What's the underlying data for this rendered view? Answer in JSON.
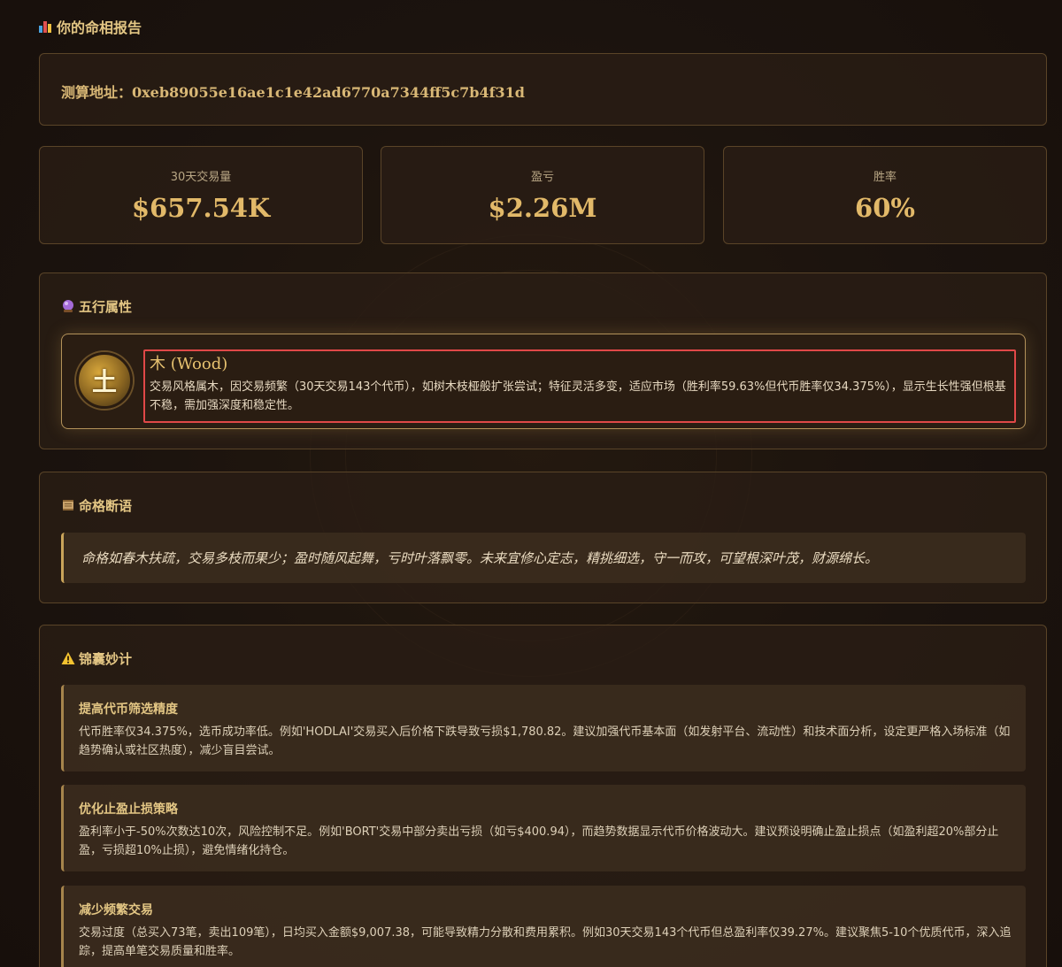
{
  "colors": {
    "accent": "#e2b969",
    "highlight": "#e04848",
    "card_border": "#5a4428"
  },
  "header": {
    "title": "你的命相报告",
    "icon": "bar-chart-icon"
  },
  "address": {
    "text": "测算地址：0xeb89055e16ae1c1e42ad6770a7344ff5c7b4f31d"
  },
  "stats": [
    {
      "label": "30天交易量",
      "value": "$657.54K"
    },
    {
      "label": "盈亏",
      "value": "$2.26M"
    },
    {
      "label": "胜率",
      "value": "60%"
    }
  ],
  "five_elements": {
    "title": "五行属性",
    "icon": "crystal-ball-icon",
    "seal_char": "土",
    "element_name": "木 (Wood)",
    "description": "交易风格属木，因交易频繁（30天交易143个代币），如树木枝桠般扩张尝试；特征灵活多变，适应市场（胜利率59.63%但代币胜率仅34.375%），显示生长性强但根基不稳，需加强深度和稳定性。"
  },
  "fate": {
    "title": "命格断语",
    "icon": "scroll-icon",
    "quote": "命格如春木扶疏，交易多枝而果少；盈时随风起舞，亏时叶落飘零。未来宜修心定志，精挑细选，守一而攻，可望根深叶茂，财源绵长。"
  },
  "tips": {
    "title": "锦囊妙计",
    "icon": "warning-icon",
    "items": [
      {
        "title": "提高代币筛选精度",
        "body": "代币胜率仅34.375%，选币成功率低。例如'HODLAI'交易买入后价格下跌导致亏损$1,780.82。建议加强代币基本面（如发射平台、流动性）和技术面分析，设定更严格入场标准（如趋势确认或社区热度），减少盲目尝试。"
      },
      {
        "title": "优化止盈止损策略",
        "body": "盈利率小于-50%次数达10次，风险控制不足。例如'BORT'交易中部分卖出亏损（如亏$400.94），而趋势数据显示代币价格波动大。建议预设明确止盈止损点（如盈利超20%部分止盈，亏损超10%止损），避免情绪化持仓。"
      },
      {
        "title": "减少频繁交易",
        "body": "交易过度（总买入73笔，卖出109笔），日均买入金额$9,007.38，可能导致精力分散和费用累积。例如30天交易143个代币但总盈利率仅39.27%。建议聚焦5-10个优质代币，深入追踪，提高单笔交易质量和胜率。"
      }
    ]
  }
}
